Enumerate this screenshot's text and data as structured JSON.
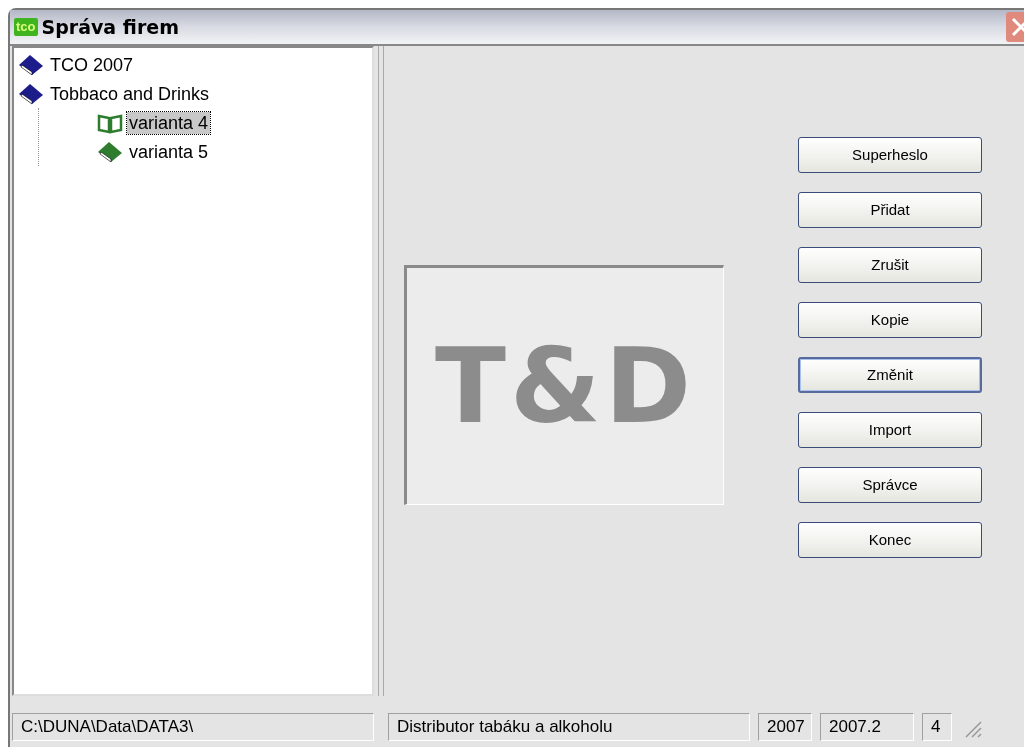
{
  "window": {
    "title": "Správa firem",
    "icon_text": "tco"
  },
  "tree": [
    {
      "label": "TCO 2007",
      "kind": "book",
      "color": "#1c1c8a",
      "selected": false
    },
    {
      "label": "Tobbaco and Drinks",
      "kind": "book",
      "color": "#1c1c8a",
      "selected": false,
      "children": [
        {
          "label": "varianta 4",
          "kind": "open-book",
          "color": "#2e7d2e",
          "selected": true
        },
        {
          "label": "varianta 5",
          "kind": "book",
          "color": "#2e7d2e",
          "selected": false
        }
      ]
    }
  ],
  "logo": "T&D",
  "buttons": [
    {
      "label": "Superheslo",
      "focused": false
    },
    {
      "label": "Přidat",
      "focused": false
    },
    {
      "label": "Zrušit",
      "focused": false
    },
    {
      "label": "Kopie",
      "focused": false
    },
    {
      "label": "Změnit",
      "focused": true
    },
    {
      "label": "Import",
      "focused": false
    },
    {
      "label": "Správce",
      "focused": false
    },
    {
      "label": "Konec",
      "focused": false
    }
  ],
  "status_bar": [
    "C:\\DUNA\\Data\\DATA3\\",
    "Distributor tabáku a alkoholu",
    "2007",
    "2007.2",
    "4"
  ]
}
